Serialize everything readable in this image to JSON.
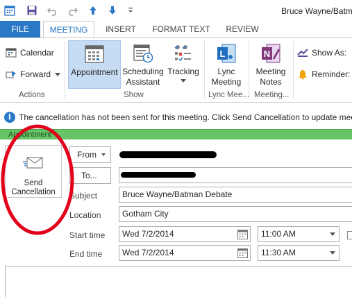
{
  "titlebar": {
    "title": "Bruce Wayne/Batm",
    "qat_icons": [
      "calendar-icon",
      "save-icon",
      "undo-icon",
      "redo-icon",
      "up-arrow-icon",
      "down-arrow-icon",
      "more-icon"
    ]
  },
  "tabs": [
    "FILE",
    "MEETING",
    "INSERT",
    "FORMAT TEXT",
    "REVIEW"
  ],
  "active_tab": "MEETING",
  "ribbon": {
    "actions": {
      "label": "Actions",
      "calendar": "Calendar",
      "forward": "Forward"
    },
    "show": {
      "label": "Show",
      "appointment": "Appointment",
      "scheduling_line1": "Scheduling",
      "scheduling_line2": "Assistant",
      "tracking": "Tracking"
    },
    "lync": {
      "label": "Lync Mee...",
      "line1": "Lync",
      "line2": "Meeting"
    },
    "meeting_notes": {
      "label": "Meeting...",
      "line1": "Meeting",
      "line2": "Notes"
    },
    "options": {
      "show_as": "Show As:",
      "reminder": "Reminder:"
    }
  },
  "infobar": {
    "message": "The cancellation has not been sent for this meeting. Click Send Cancellation to update mee"
  },
  "banner": {
    "text": "Appointment"
  },
  "send_cancellation": {
    "line1": "Send",
    "line2": "Cancellation"
  },
  "form": {
    "from_label": "From",
    "to_label": "To...",
    "subject_label": "Subject",
    "subject_value": "Bruce Wayne/Batman Debate",
    "location_label": "Location",
    "location_value": "Gotham City",
    "start_label": "Start time",
    "start_date": "Wed 7/2/2014",
    "start_time": "11:00 AM",
    "end_label": "End time",
    "end_date": "Wed 7/2/2014",
    "end_time": "11:30 AM"
  },
  "colors": {
    "accent": "#2a79c6",
    "banner_green": "#67c567",
    "annotation_red": "#e2001a"
  }
}
